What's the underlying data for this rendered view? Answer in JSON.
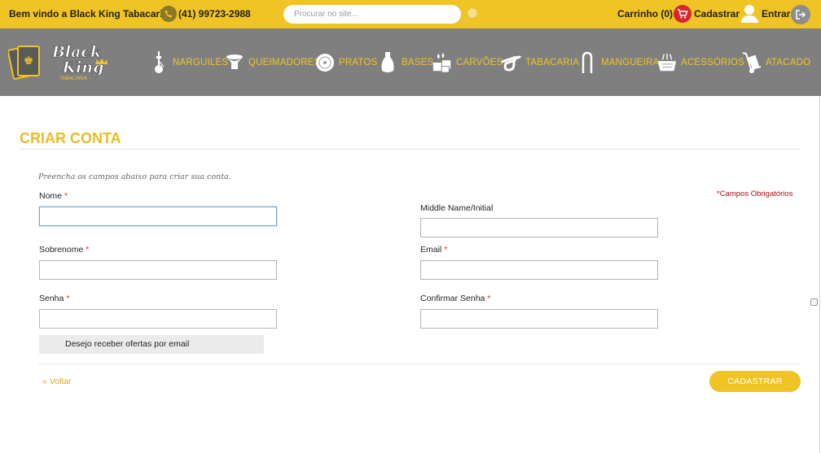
{
  "topbar": {
    "welcome": "Bem vindo a Black King Tabacaria",
    "phone": "(41) 99723-2988",
    "search_placeholder": "Procurar no site...",
    "cart": "Carrinho (0)",
    "signup": "Cadastrar",
    "login": "Entrar"
  },
  "brand": {
    "logo_line1": "Black",
    "logo_line2": "King",
    "logo_sub": "TABACARIA",
    "colors": {
      "accent": "#f0c424",
      "nav_bg": "#7f7f7f",
      "cart_red": "#d8262e"
    }
  },
  "nav": [
    {
      "label": "NARGUILES",
      "icon": "hookah-icon"
    },
    {
      "label": "QUEIMADORES",
      "icon": "burner-icon"
    },
    {
      "label": "PRATOS",
      "icon": "plate-icon"
    },
    {
      "label": "BASES",
      "icon": "vase-icon"
    },
    {
      "label": "CARVÕES",
      "icon": "coal-icon"
    },
    {
      "label": "TABACARIA",
      "icon": "pipe-icon"
    },
    {
      "label": "MANGUEIRA",
      "icon": "hose-icon"
    },
    {
      "label": "ACESSÓRIOS",
      "icon": "basket-icon"
    },
    {
      "label": "ATACADO",
      "icon": "hand-truck-icon"
    }
  ],
  "form": {
    "title": "CRIAR CONTA",
    "intro": "Preencha os campos abaixo para criar sua conta.",
    "required_note": "*Campos Obrigatórios",
    "required_mark": "*",
    "fields": {
      "first_name": {
        "label": "Nome",
        "value": ""
      },
      "middle_name": {
        "label": "Middle Name/Initial",
        "value": ""
      },
      "last_name": {
        "label": "Sobrenome",
        "value": ""
      },
      "email": {
        "label": "Email",
        "value": ""
      },
      "password": {
        "label": "Senha",
        "value": ""
      },
      "confirm_password": {
        "label": "Confirmar Senha",
        "value": ""
      }
    },
    "newsletter_label": "Desejo receber ofertas por email",
    "back_link": "« Voltar",
    "submit": "CADASTRAR"
  }
}
